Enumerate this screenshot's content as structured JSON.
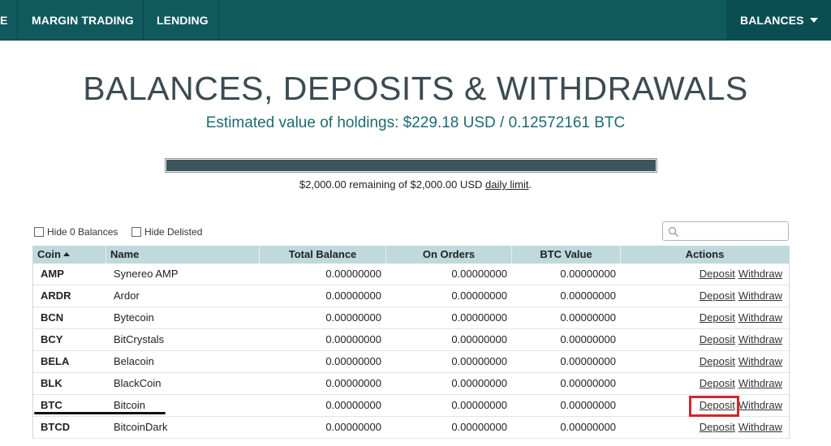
{
  "nav": {
    "partial_item": "E",
    "items": [
      "MARGIN TRADING",
      "LENDING"
    ],
    "balances": "BALANCES"
  },
  "header": {
    "title": "BALANCES, DEPOSITS & WITHDRAWALS",
    "estimate": "Estimated value of holdings: $229.18 USD / 0.12572161 BTC"
  },
  "limit": {
    "fraction": 1.0,
    "text_prefix": "$2,000.00 remaining of $2,000.00 USD ",
    "link": "daily limit",
    "text_suffix": "."
  },
  "filters": {
    "hide_zero": "Hide 0 Balances",
    "hide_delisted": "Hide Delisted",
    "search_placeholder": ""
  },
  "table": {
    "headers": {
      "coin": "Coin",
      "name": "Name",
      "total": "Total Balance",
      "orders": "On Orders",
      "btc": "BTC Value",
      "actions": "Actions"
    },
    "deposit_label": "Deposit",
    "withdraw_label": "Withdraw",
    "rows": [
      {
        "coin": "AMP",
        "name": "Synereo AMP",
        "total": "0.00000000",
        "orders": "0.00000000",
        "btc": "0.00000000"
      },
      {
        "coin": "ARDR",
        "name": "Ardor",
        "total": "0.00000000",
        "orders": "0.00000000",
        "btc": "0.00000000"
      },
      {
        "coin": "BCN",
        "name": "Bytecoin",
        "total": "0.00000000",
        "orders": "0.00000000",
        "btc": "0.00000000"
      },
      {
        "coin": "BCY",
        "name": "BitCrystals",
        "total": "0.00000000",
        "orders": "0.00000000",
        "btc": "0.00000000"
      },
      {
        "coin": "BELA",
        "name": "Belacoin",
        "total": "0.00000000",
        "orders": "0.00000000",
        "btc": "0.00000000"
      },
      {
        "coin": "BLK",
        "name": "BlackCoin",
        "total": "0.00000000",
        "orders": "0.00000000",
        "btc": "0.00000000"
      },
      {
        "coin": "BTC",
        "name": "Bitcoin",
        "total": "0.00000000",
        "orders": "0.00000000",
        "btc": "0.00000000"
      },
      {
        "coin": "BTCD",
        "name": "BitcoinDark",
        "total": "0.00000000",
        "orders": "0.00000000",
        "btc": "0.00000000"
      }
    ]
  },
  "colors": {
    "nav_bg": "#105a5e",
    "header_row_bg": "#bfd9dc",
    "estimate_text": "#1e6b6f",
    "highlight_box": "#d0262b"
  }
}
